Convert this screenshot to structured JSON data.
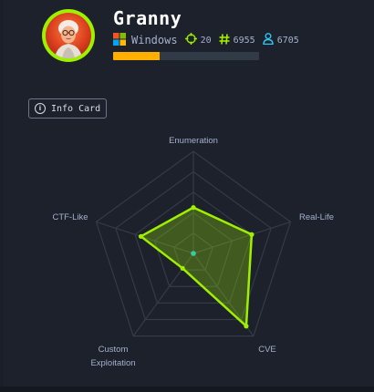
{
  "machine": {
    "name": "Granny",
    "os": "Windows",
    "points": "20",
    "user_owns": "6955",
    "system_owns": "6705",
    "progress_percent": 32
  },
  "info_button": {
    "label": "Info Card"
  },
  "icons": {
    "os": "windows-logo-icon",
    "points": "crosshair-icon",
    "user_owns": "hash-icon",
    "system_owns": "user-icon",
    "info": "info-icon"
  },
  "colors": {
    "accent_green": "#9fef00",
    "progress_fill": "#ffaf00",
    "background": "#1c212b"
  },
  "chart_data": {
    "type": "radar",
    "axes": [
      "Enumeration",
      "Real-Life",
      "CVE",
      "Custom Exploitation",
      "CTF-Like"
    ],
    "axis_label_lines": [
      [
        "Enumeration"
      ],
      [
        "Real-Life"
      ],
      [
        "CVE"
      ],
      [
        "Custom",
        "Exploitation"
      ],
      [
        "CTF-Like"
      ]
    ],
    "range": [
      0,
      10
    ],
    "rings": 5,
    "values": [
      4.5,
      6.0,
      8.8,
      1.8,
      5.4
    ],
    "series_color": "#9fef00"
  }
}
